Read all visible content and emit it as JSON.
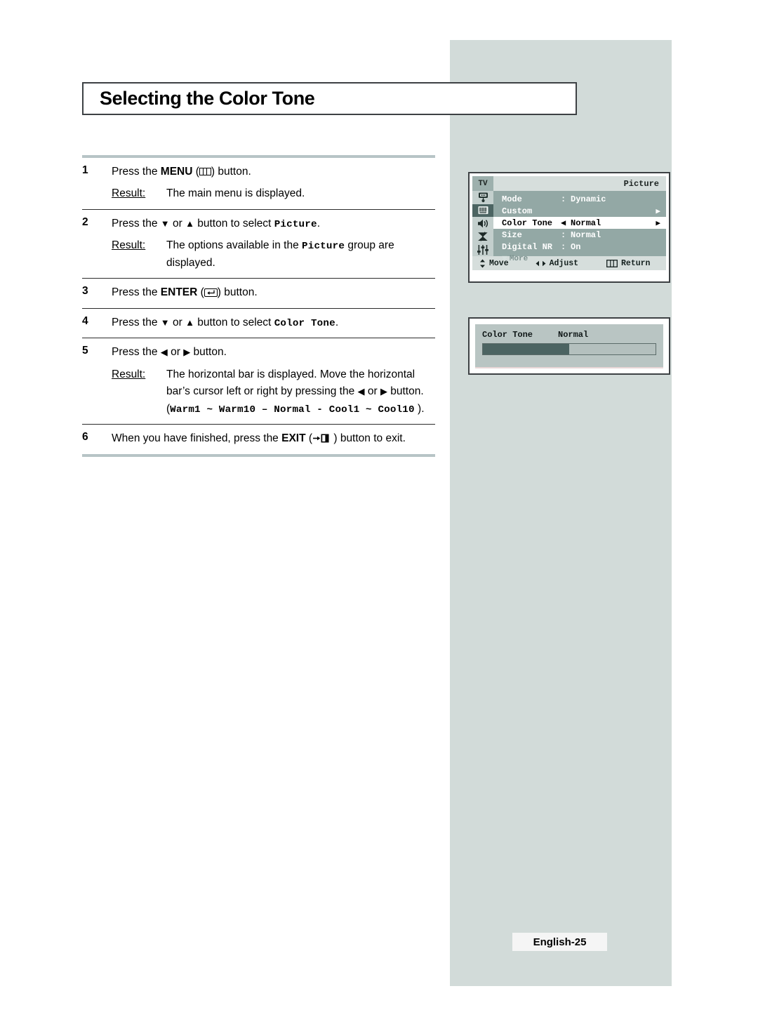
{
  "page": {
    "title": "Selecting the Color Tone",
    "footer_label": "English-25"
  },
  "colors": {
    "panel_bg": "#d2dbd9",
    "osd_list_bg": "#93a8a5",
    "osd_header_bg": "#d6dedc",
    "osd_accent": "#4c6462",
    "rule": "#b7c4c6"
  },
  "steps": [
    {
      "num": "1",
      "text_before": "Press the ",
      "bold": "MENU",
      "paren_open": " (",
      "icon": "menu-icon",
      "paren_close": ") button.",
      "result_label": "Result:",
      "result_text": "The main menu is displayed."
    },
    {
      "num": "2",
      "lead": "Press the ",
      "down": "▼",
      "or": " or ",
      "up": "▲",
      "mid": " button to select ",
      "mono": "Picture",
      "tail": ".",
      "result_label": "Result:",
      "result_a": "The options available in the ",
      "result_mono": "Picture",
      "result_b": " group are displayed."
    },
    {
      "num": "3",
      "text_before": "Press the ",
      "bold": "ENTER",
      "paren_open": " (",
      "icon": "enter-icon",
      "paren_close": ") button."
    },
    {
      "num": "4",
      "lead": "Press the ",
      "down": "▼",
      "or": " or ",
      "up": "▲",
      "mid": " button to select ",
      "mono": "Color Tone",
      "tail": "."
    },
    {
      "num": "5",
      "lead": "Press the ",
      "left": "◀",
      "or": " or ",
      "right": "▶",
      "mid": " button.",
      "result_label": "Result:",
      "result_a": "The horizontal bar is displayed. Move the horizontal bar’s cursor left or right by pressing the ",
      "result_left": "◀",
      "result_or": " or ",
      "result_right": "▶",
      "result_b": " button. (",
      "result_mono": "Warm1 ~ Warm10 – Normal - Cool1 ~ Cool10",
      "result_c": " )."
    },
    {
      "num": "6",
      "text_before": "When you have finished, press the ",
      "bold": "EXIT",
      "paren_open": " (",
      "icon": "exit-icon",
      "paren_close": " ) button to exit."
    }
  ],
  "osd_main": {
    "tv_label": "TV",
    "title": "Picture",
    "icons": [
      {
        "name": "tv-monitor-icon",
        "active": false
      },
      {
        "name": "picture-bars-icon",
        "active": true
      },
      {
        "name": "speaker-icon",
        "active": false
      },
      {
        "name": "satellite-dish-icon",
        "active": false
      },
      {
        "name": "sliders-icon",
        "active": false
      }
    ],
    "rows": [
      {
        "label": "Mode",
        "sep": ":",
        "value": "Dynamic",
        "arrow_right": false,
        "selected": false
      },
      {
        "label": "Custom",
        "sep": "",
        "value": "",
        "arrow_right": true,
        "selected": false
      },
      {
        "label": "Color Tone",
        "sep": "◀",
        "value": "Normal",
        "arrow_right": true,
        "selected": true
      },
      {
        "label": "Size",
        "sep": ":",
        "value": "Normal",
        "arrow_right": false,
        "selected": false
      },
      {
        "label": "Digital NR",
        "sep": ":",
        "value": "On",
        "arrow_right": false,
        "selected": false
      }
    ],
    "more_label": "More",
    "footer": {
      "move": "Move",
      "adjust": "Adjust",
      "return": "Return"
    }
  },
  "osd_bar": {
    "label": "Color Tone",
    "value": "Normal",
    "fill_percent": 50
  }
}
